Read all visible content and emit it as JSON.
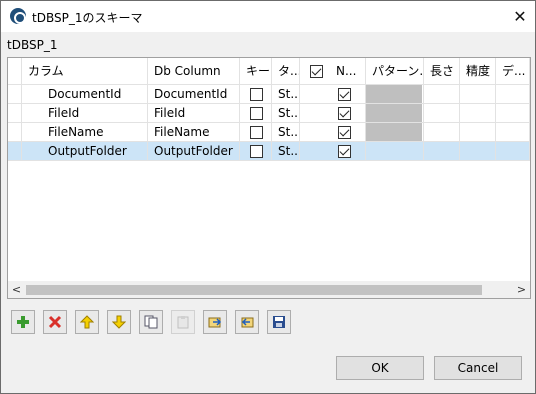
{
  "window": {
    "title": "tDBSP_1のスキーマ",
    "close_glyph": "✕"
  },
  "schema_name": "tDBSP_1",
  "table": {
    "headers": [
      "カラム",
      "Db Column",
      "キー",
      "タ...",
      "N...",
      "パターン...",
      "長さ",
      "精度",
      "デ..."
    ],
    "rows": [
      {
        "column": "DocumentId",
        "db_column": "DocumentId",
        "key": false,
        "type": "St...",
        "nullable": true,
        "pattern_disabled": true
      },
      {
        "column": "FileId",
        "db_column": "FileId",
        "key": false,
        "type": "St...",
        "nullable": true,
        "pattern_disabled": true
      },
      {
        "column": "FileName",
        "db_column": "FileName",
        "key": false,
        "type": "St...",
        "nullable": true,
        "pattern_disabled": true
      },
      {
        "column": "OutputFolder",
        "db_column": "OutputFolder",
        "key": false,
        "type": "St...",
        "nullable": true,
        "pattern_disabled": false,
        "selected": true
      }
    ],
    "header_nullable_checked": true,
    "scroll_left": "<",
    "scroll_right": ">"
  },
  "toolbar_icons": [
    "add-icon",
    "delete-icon",
    "move-up-icon",
    "move-down-icon",
    "copy-icon",
    "paste-icon",
    "import-icon",
    "export-icon",
    "save-icon"
  ],
  "buttons": {
    "ok": "OK",
    "cancel": "Cancel"
  },
  "colors": {
    "selection": "#cce4f7",
    "add": "#3a9b2f",
    "delete": "#d9302a",
    "arrow": "#e8b800",
    "save": "#2a4d8f"
  }
}
